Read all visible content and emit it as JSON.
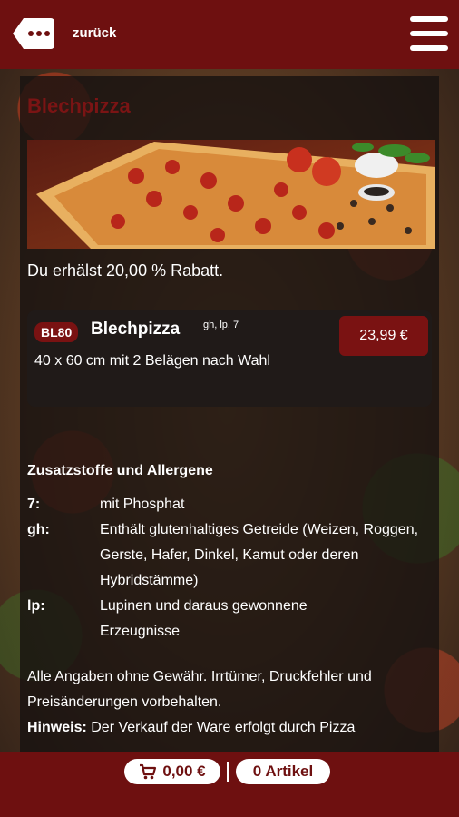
{
  "header": {
    "back_label": "zurück"
  },
  "category": {
    "title": "Blechpizza",
    "discount_text": "Du erhälst 20,00 % Rabatt."
  },
  "product": {
    "code": "BL80",
    "name": "Blechpizza",
    "allergen_codes": "gh, lp, 7",
    "description": "40 x 60 cm mit 2 Belägen nach Wahl",
    "price": "23,99 €"
  },
  "allergens": {
    "title": "Zusatzstoffe und Allergene",
    "items": [
      {
        "key": "7:",
        "value": "mit Phosphat"
      },
      {
        "key": "gh:",
        "value": "Enthält glutenhaltiges Getreide (Weizen, Roggen, Gerste, Hafer, Dinkel, Kamut oder deren Hybridstämme)"
      },
      {
        "key": "lp:",
        "value": "Lupinen und daraus gewonnene Erzeugnisse"
      }
    ]
  },
  "footer_text": {
    "disclaimer": "Alle Angaben ohne Gewähr. Irrtümer, Druckfehler und Preisänderungen vorbehalten.",
    "hint_label": "Hinweis:",
    "hint_text": "Der Verkauf der Ware erfolgt durch Pizza"
  },
  "cart": {
    "total": "0,00 €",
    "items": "0 Artikel"
  },
  "icons": {
    "back": "back-bubble-icon",
    "menu": "hamburger-menu-icon",
    "cart": "cart-icon"
  },
  "colors": {
    "brand": "#6e1010",
    "badge": "#7a1212"
  }
}
